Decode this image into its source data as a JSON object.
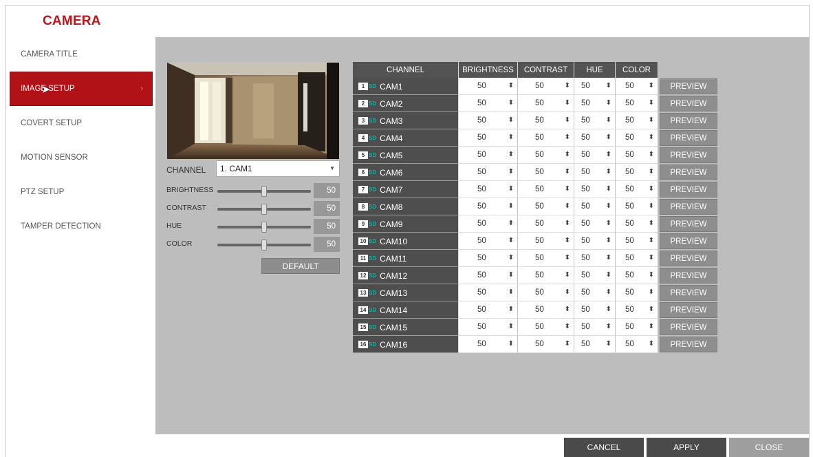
{
  "header": {
    "title": "CAMERA"
  },
  "sidebar": {
    "items": [
      {
        "label": "CAMERA TITLE"
      },
      {
        "label": "IMAGE SETUP",
        "active": true
      },
      {
        "label": "COVERT SETUP"
      },
      {
        "label": "MOTION SENSOR"
      },
      {
        "label": "PTZ SETUP"
      },
      {
        "label": "TAMPER DETECTION"
      }
    ]
  },
  "left_panel": {
    "channel_label": "CHANNEL",
    "channel_value": "1. CAM1",
    "sliders": [
      {
        "label": "BRIGHTNESS",
        "value": "50",
        "level": 0.5
      },
      {
        "label": "CONTRAST",
        "value": "50",
        "level": 0.5
      },
      {
        "label": "HUE",
        "value": "50",
        "level": 0.5
      },
      {
        "label": "COLOR",
        "value": "50",
        "level": 0.5
      }
    ],
    "default_label": "DEFAULT"
  },
  "table": {
    "headers": [
      "CHANNEL",
      "BRIGHTNESS",
      "CONTRAST",
      "HUE",
      "COLOR"
    ],
    "preview_label": "PREVIEW",
    "rows": [
      {
        "num": "1",
        "name": "CAM1",
        "brightness": "50",
        "contrast": "50",
        "hue": "50",
        "color": "50"
      },
      {
        "num": "2",
        "name": "CAM2",
        "brightness": "50",
        "contrast": "50",
        "hue": "50",
        "color": "50"
      },
      {
        "num": "3",
        "name": "CAM3",
        "brightness": "50",
        "contrast": "50",
        "hue": "50",
        "color": "50"
      },
      {
        "num": "4",
        "name": "CAM4",
        "brightness": "50",
        "contrast": "50",
        "hue": "50",
        "color": "50"
      },
      {
        "num": "5",
        "name": "CAM5",
        "brightness": "50",
        "contrast": "50",
        "hue": "50",
        "color": "50"
      },
      {
        "num": "6",
        "name": "CAM6",
        "brightness": "50",
        "contrast": "50",
        "hue": "50",
        "color": "50"
      },
      {
        "num": "7",
        "name": "CAM7",
        "brightness": "50",
        "contrast": "50",
        "hue": "50",
        "color": "50"
      },
      {
        "num": "8",
        "name": "CAM8",
        "brightness": "50",
        "contrast": "50",
        "hue": "50",
        "color": "50"
      },
      {
        "num": "9",
        "name": "CAM9",
        "brightness": "50",
        "contrast": "50",
        "hue": "50",
        "color": "50"
      },
      {
        "num": "10",
        "name": "CAM10",
        "brightness": "50",
        "contrast": "50",
        "hue": "50",
        "color": "50"
      },
      {
        "num": "11",
        "name": "CAM11",
        "brightness": "50",
        "contrast": "50",
        "hue": "50",
        "color": "50"
      },
      {
        "num": "12",
        "name": "CAM12",
        "brightness": "50",
        "contrast": "50",
        "hue": "50",
        "color": "50"
      },
      {
        "num": "13",
        "name": "CAM13",
        "brightness": "50",
        "contrast": "50",
        "hue": "50",
        "color": "50"
      },
      {
        "num": "14",
        "name": "CAM14",
        "brightness": "50",
        "contrast": "50",
        "hue": "50",
        "color": "50"
      },
      {
        "num": "15",
        "name": "CAM15",
        "brightness": "50",
        "contrast": "50",
        "hue": "50",
        "color": "50"
      },
      {
        "num": "16",
        "name": "CAM16",
        "brightness": "50",
        "contrast": "50",
        "hue": "50",
        "color": "50"
      }
    ]
  },
  "footer": {
    "cancel_label": "CANCEL",
    "apply_label": "APPLY",
    "close_label": "CLOSE"
  },
  "colors": {
    "accent": "#c0151b",
    "active_menu": "#b01218",
    "panel_bg": "#bdbdbd"
  },
  "icons": {
    "sd_badge": "sd-badge-icon",
    "spinner": "spinner-arrows-icon",
    "dropdown": "chevron-down-icon"
  }
}
